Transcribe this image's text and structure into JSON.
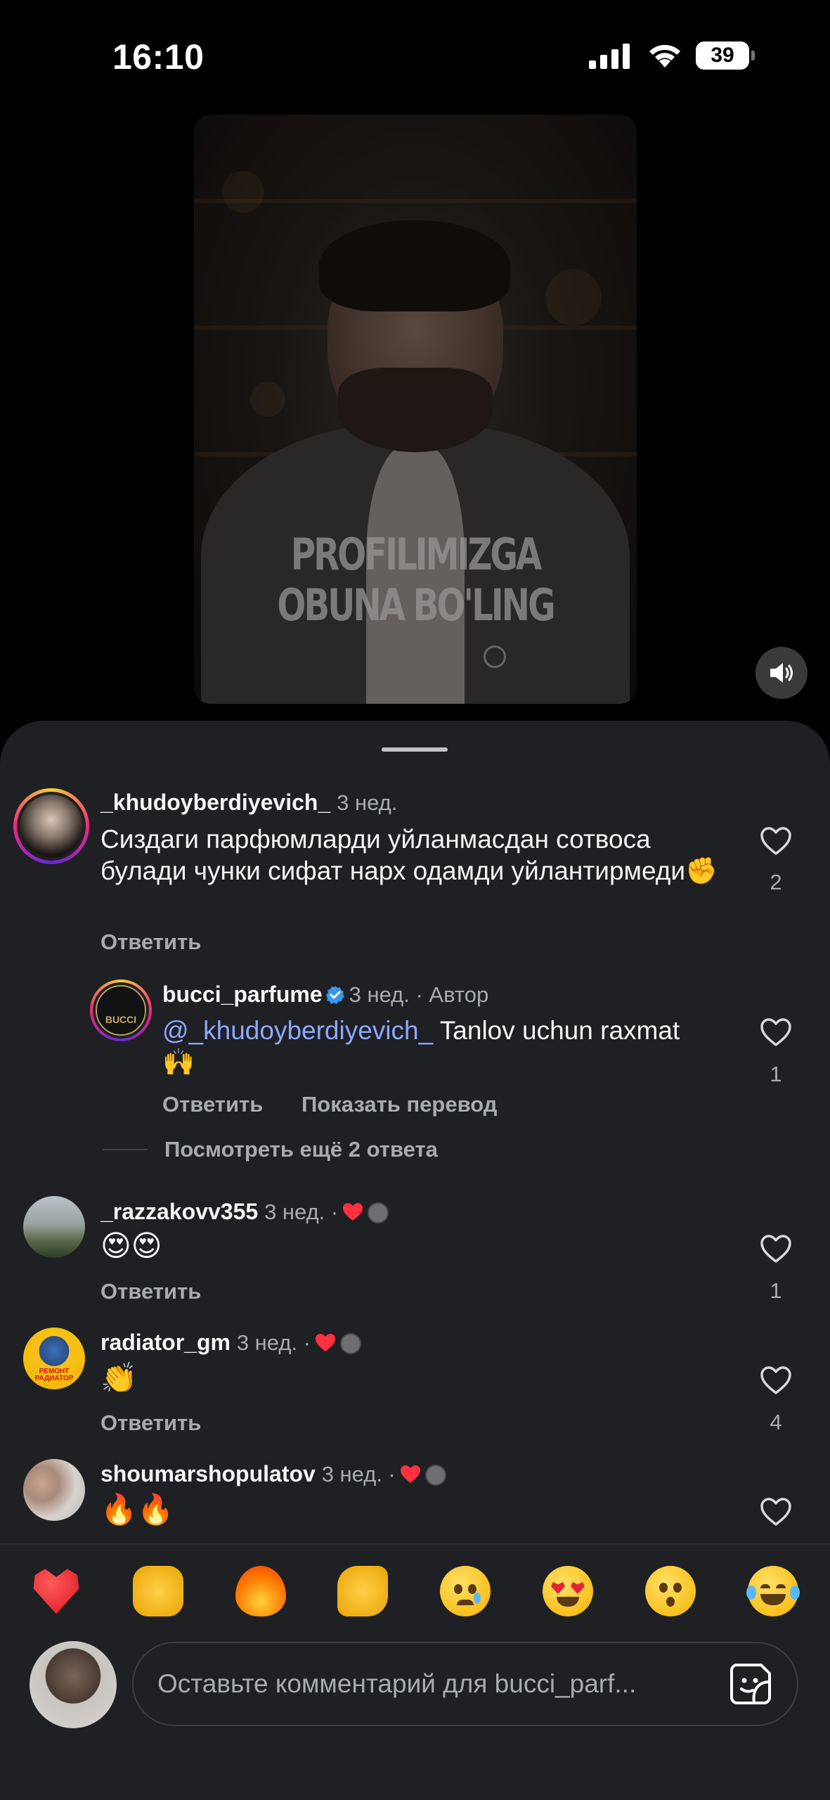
{
  "status_bar": {
    "time": "16:10",
    "battery": "39"
  },
  "video": {
    "caption_line1": "PROFILIMIZGA",
    "caption_line2": "OBUNA BO'LING"
  },
  "comments": [
    {
      "username": "_khudoyberdiyevich_",
      "time": "3 нед.",
      "text": "Сиздаги парфюмларди уйланмасдан сотвоса булади чунки сифат нарх одамди уйлантирмеди",
      "emoji": "✊",
      "reply_label": "Ответить",
      "likes": "2"
    },
    {
      "username": "bucci_parfume",
      "time": "3 нед. · Автор",
      "mention": "@_khudoyberdiyevich_",
      "text": " Tanlov uchun raxmat",
      "emoji": "🙌",
      "reply_label": "Ответить",
      "translate_label": "Показать перевод",
      "likes": "1",
      "avatar_label": "BUCCI"
    },
    {
      "view_more_label": "Посмотреть ещё 2 ответа"
    },
    {
      "username": "_razzakovv355",
      "time": "3 нед. ·",
      "emoji": "😍😍",
      "reply_label": "Ответить",
      "likes": "1"
    },
    {
      "username": "radiator_gm",
      "time": "3 нед. ·",
      "emoji": "👏",
      "reply_label": "Ответить",
      "likes": "4",
      "avatar_label": "РЕМОНТ РАДИАТОР"
    },
    {
      "username": "shoumarshopulatov",
      "time": "3 нед. ·",
      "emoji": "🔥🔥"
    }
  ],
  "emoji_bar": [
    "red-heart",
    "raising-hands",
    "fire",
    "clapping-hands",
    "crying-face",
    "heart-eyes",
    "astonished-face",
    "tears-of-joy"
  ],
  "input": {
    "placeholder": "Оставьте комментарий для bucci_parf..."
  },
  "colors": {
    "sheet_bg": "#1e2023",
    "mention": "#8fa8ff",
    "secondary_text": "#a8abb0",
    "verified": "#3897f0",
    "like_heart": "#ff3040"
  }
}
